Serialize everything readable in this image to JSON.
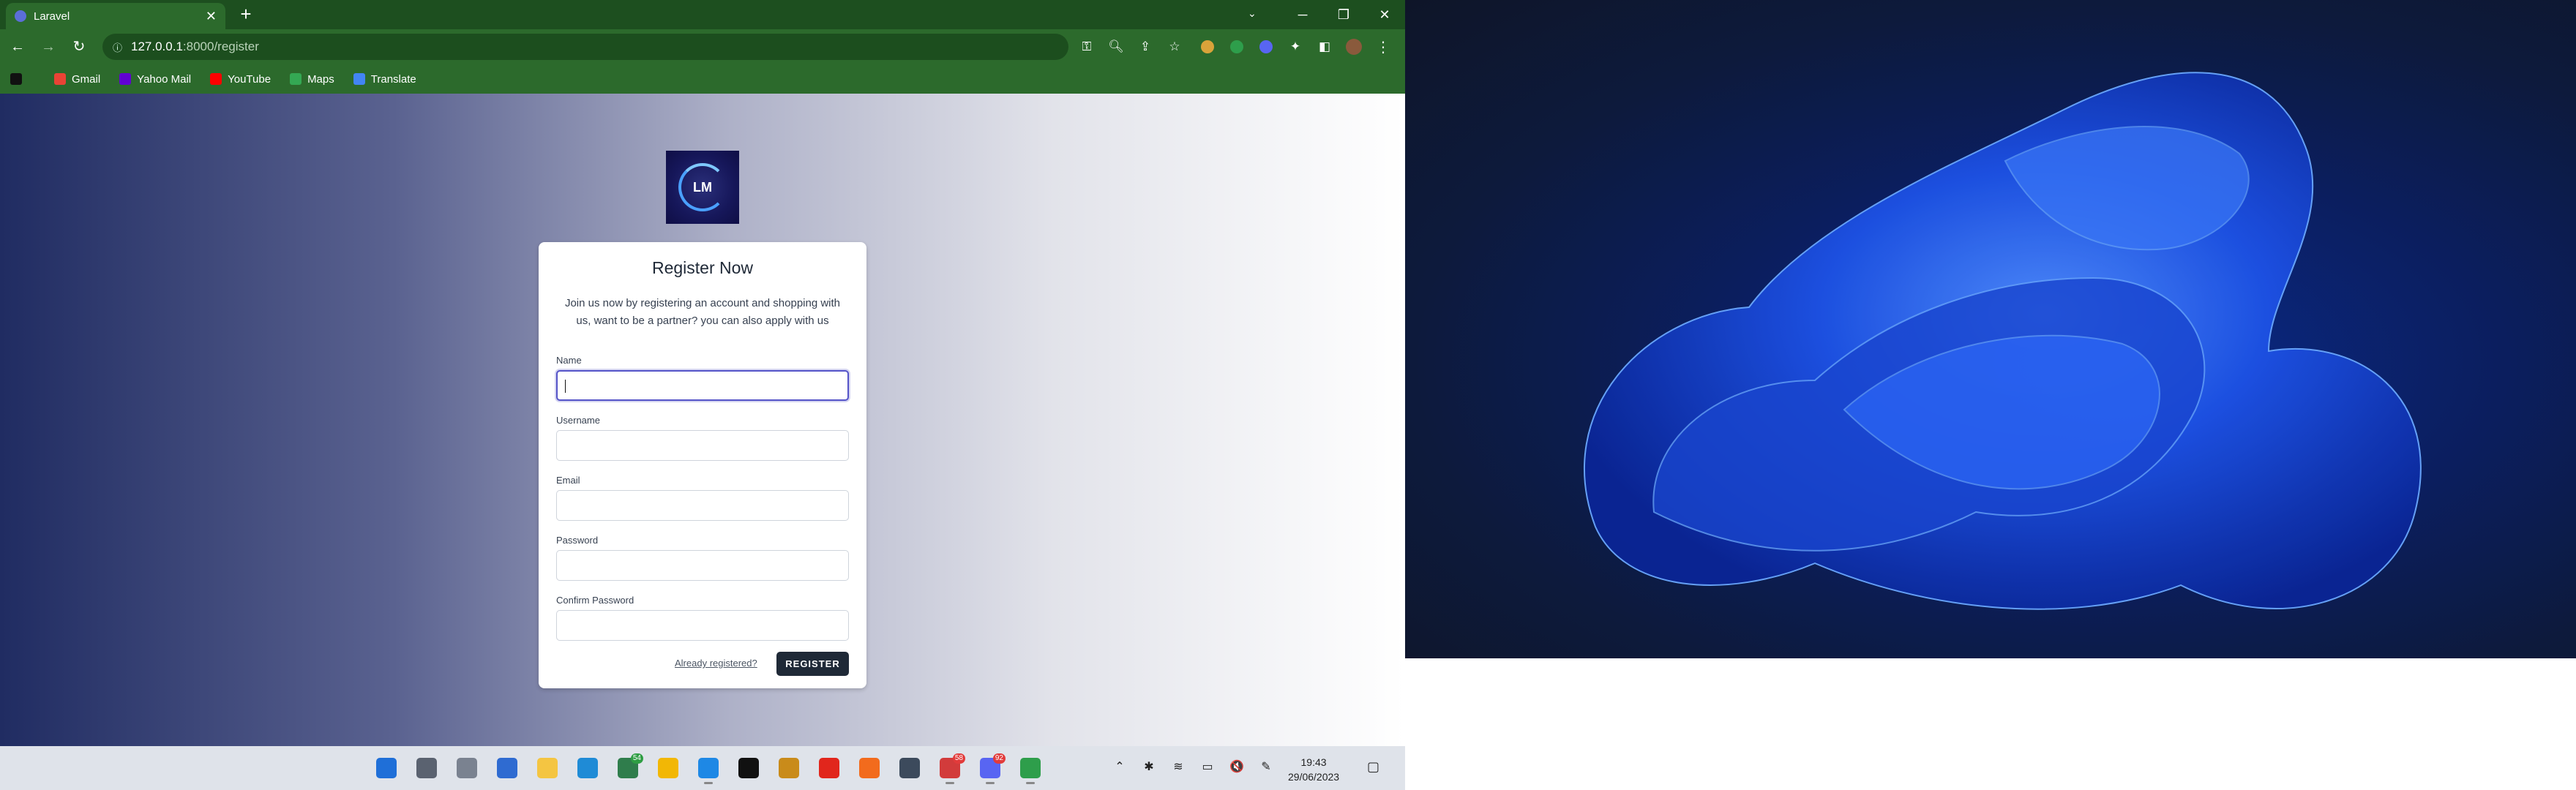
{
  "browser": {
    "tab_title": "Laravel",
    "tab_close": "✕",
    "new_tab": "+",
    "tab_dropdown": "⌄",
    "win_controls": {
      "minimize": "─",
      "restore": "❐",
      "close": "✕"
    },
    "nav": {
      "back": "←",
      "forward": "→",
      "reload": "↻"
    },
    "url_host": "127.0.0.1",
    "url_rest": ":8000/register",
    "omni_icons": [
      "key-icon",
      "zoom-icon",
      "share-icon",
      "star-icon"
    ],
    "extension_colors": [
      "#d9a33a",
      "#2e9e4b",
      "#5865f2"
    ],
    "bookmarks": [
      {
        "label": "Gmail",
        "color": "#ea4335"
      },
      {
        "label": "Yahoo Mail",
        "color": "#6001d2"
      },
      {
        "label": "YouTube",
        "color": "#ff0000"
      },
      {
        "label": "Maps",
        "color": "#34a853"
      },
      {
        "label": "Translate",
        "color": "#4285f4"
      }
    ]
  },
  "page": {
    "logo_text": "LM",
    "title": "Register Now",
    "intro": "Join us now by registering an account and shopping with us, want to be a partner? you can also apply with us",
    "fields": [
      {
        "label": "Name",
        "value": ""
      },
      {
        "label": "Username",
        "value": ""
      },
      {
        "label": "Email",
        "value": ""
      },
      {
        "label": "Password",
        "value": ""
      },
      {
        "label": "Confirm Password",
        "value": ""
      }
    ],
    "already_link": "Already registered?",
    "register_button": "REGISTER"
  },
  "taskbar": {
    "apps": [
      {
        "name": "start-icon",
        "color": "#1f6fd8"
      },
      {
        "name": "search-icon",
        "color": "#5a6270"
      },
      {
        "name": "task-view-icon",
        "color": "#7a8290"
      },
      {
        "name": "widgets-icon",
        "color": "#2f6bd1"
      },
      {
        "name": "file-explorer-icon",
        "color": "#f4c542"
      },
      {
        "name": "edge-icon",
        "color": "#1f8bd6"
      },
      {
        "name": "teams-icon",
        "color": "#2f7d4c",
        "badge": "54",
        "badge_green": true
      },
      {
        "name": "store-icon",
        "color": "#f2b705"
      },
      {
        "name": "vscode-icon",
        "color": "#1e88e5",
        "running": true
      },
      {
        "name": "netflix-icon",
        "color": "#111111"
      },
      {
        "name": "filezilla-icon",
        "color": "#c98b1a"
      },
      {
        "name": "opera-icon",
        "color": "#e1261c"
      },
      {
        "name": "xampp-icon",
        "color": "#f26b1d"
      },
      {
        "name": "3d-viewer-icon",
        "color": "#3c4a5c"
      },
      {
        "name": "slack-icon",
        "color": "#d23b3b",
        "badge": "58",
        "running": true
      },
      {
        "name": "discord-icon",
        "color": "#5865f2",
        "badge": "92",
        "running": true
      },
      {
        "name": "chrome-icon",
        "color": "#2e9e4b",
        "running": true
      }
    ],
    "tray": [
      "⌃",
      "✱",
      "≋",
      "▭",
      "🔇",
      "✎"
    ],
    "time": "19:43",
    "date": "29/06/2023",
    "notification": "▢"
  }
}
